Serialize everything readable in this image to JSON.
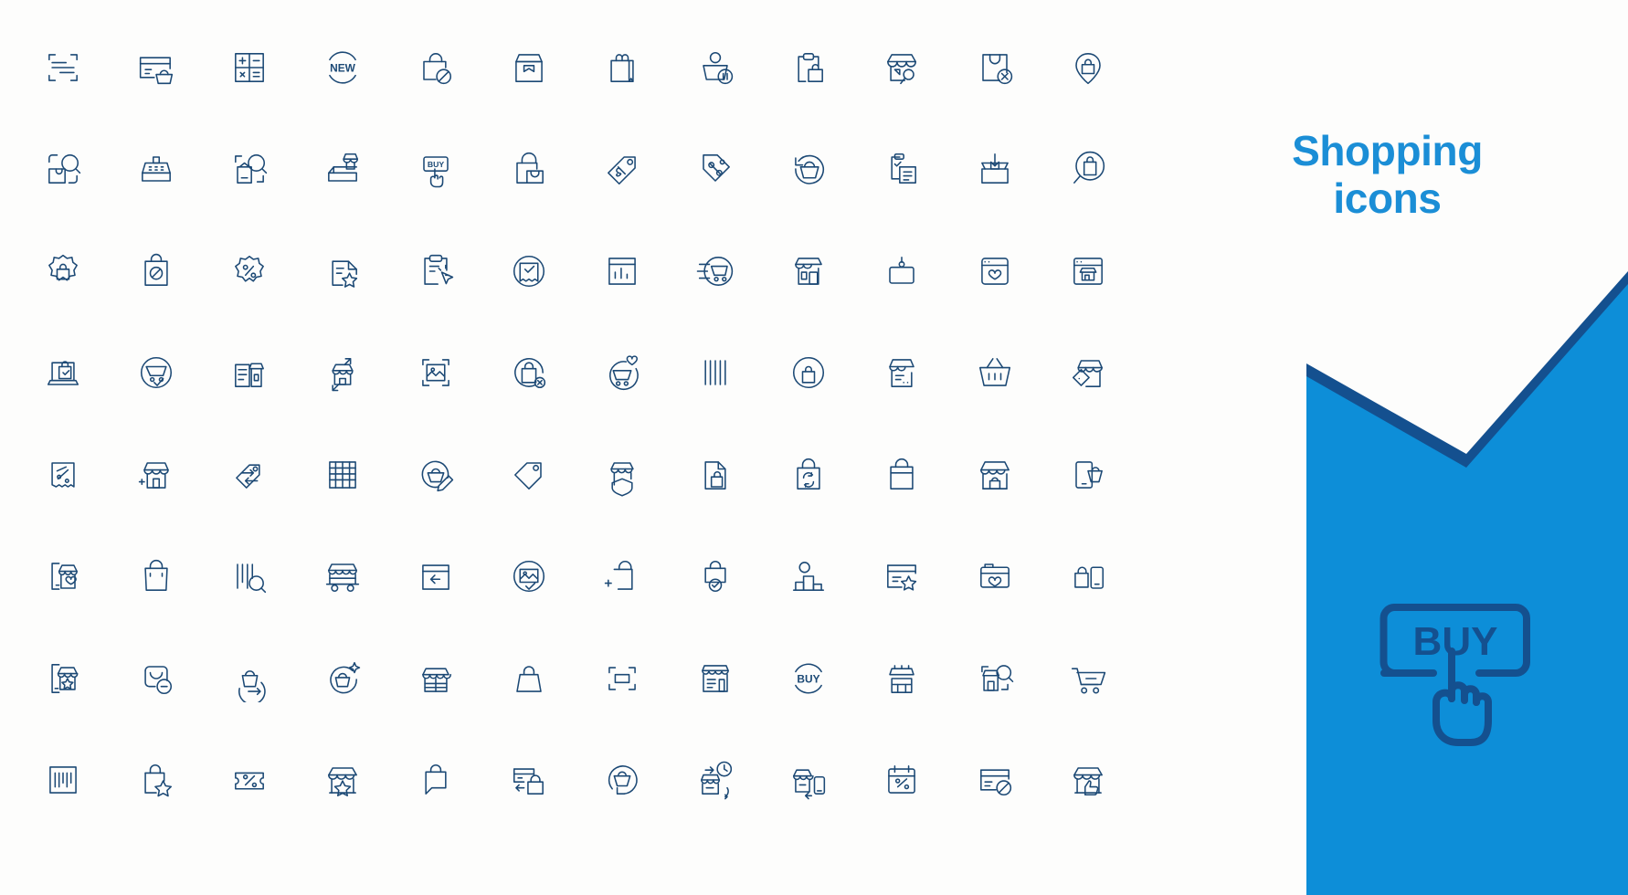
{
  "panel": {
    "title": "Shopping\nicons",
    "title_color": "#1b8ed6",
    "body_color": "#0d8ed8",
    "edge_color": "#14508f",
    "buy_label": "BUY"
  },
  "grid": {
    "columns": 12,
    "rows": 8,
    "stroke_color": "#1c4975",
    "icons": [
      {
        "name": "barcode-scan-frame-icon",
        "label": "Barcode scan frame"
      },
      {
        "name": "credit-card-basket-icon",
        "label": "Credit card with basket"
      },
      {
        "name": "calculator-icon",
        "label": "Calculator"
      },
      {
        "name": "new-badge-icon",
        "label": "NEW badge"
      },
      {
        "name": "bag-blocked-icon",
        "label": "Shopping bag blocked"
      },
      {
        "name": "package-box-icon",
        "label": "Package box"
      },
      {
        "name": "paper-shopping-bag-icon",
        "label": "Paper shopping bag"
      },
      {
        "name": "basket-customer-pause-icon",
        "label": "Customer basket paused"
      },
      {
        "name": "clipboard-bag-icon",
        "label": "Clipboard with bag"
      },
      {
        "name": "store-search-icon",
        "label": "Store search"
      },
      {
        "name": "bag-remove-icon",
        "label": "Bag remove"
      },
      {
        "name": "bag-location-pin-icon",
        "label": "Bag location pin"
      },
      {
        "name": "bag-search-frame-icon",
        "label": "Bag search frame"
      },
      {
        "name": "cash-register-icon",
        "label": "Cash register"
      },
      {
        "name": "product-search-frame-icon",
        "label": "Product search frame"
      },
      {
        "name": "store-delivery-icon",
        "label": "Store delivery"
      },
      {
        "name": "buy-button-tap-icon",
        "label": "Buy button tap"
      },
      {
        "name": "bag-in-bag-icon",
        "label": "Bag inside bag"
      },
      {
        "name": "price-tags-icon",
        "label": "Price tags"
      },
      {
        "name": "discount-tag-icon",
        "label": "Discount percent tag"
      },
      {
        "name": "basket-refresh-icon",
        "label": "Basket refresh"
      },
      {
        "name": "checklist-clipboard-icon",
        "label": "Checklist clipboard"
      },
      {
        "name": "box-download-icon",
        "label": "Box download"
      },
      {
        "name": "bag-magnifier-icon",
        "label": "Bag magnifier"
      },
      {
        "name": "bag-discount-badge-icon",
        "label": "Bag discount badge"
      },
      {
        "name": "bag-blocked-square-icon",
        "label": "Bag blocked square"
      },
      {
        "name": "percent-badge-icon",
        "label": "Percent badge"
      },
      {
        "name": "favorite-list-icon",
        "label": "Favorite list"
      },
      {
        "name": "clipboard-click-icon",
        "label": "Clipboard click"
      },
      {
        "name": "receipt-check-circle-icon",
        "label": "Receipt check circle"
      },
      {
        "name": "sales-chart-icon",
        "label": "Sales chart"
      },
      {
        "name": "fast-cart-icon",
        "label": "Fast cart"
      },
      {
        "name": "mobile-store-icon",
        "label": "Mobile store"
      },
      {
        "name": "signboard-icon",
        "label": "Hanging signboard"
      },
      {
        "name": "favorite-store-icon",
        "label": "Favorite store"
      },
      {
        "name": "store-browser-icon",
        "label": "Online store browser"
      },
      {
        "name": "laptop-bag-check-icon",
        "label": "Laptop bag check"
      },
      {
        "name": "cart-check-circle-icon",
        "label": "Cart check circle"
      },
      {
        "name": "store-receipt-icon",
        "label": "Store receipt"
      },
      {
        "name": "store-transfer-icon",
        "label": "Store transfer"
      },
      {
        "name": "product-image-frame-icon",
        "label": "Product image frame"
      },
      {
        "name": "bag-remove-circle-icon",
        "label": "Bag remove circle"
      },
      {
        "name": "cart-favorite-circle-icon",
        "label": "Cart favorite circle"
      },
      {
        "name": "barcode-lines-icon",
        "label": "Barcode lines"
      },
      {
        "name": "bag-circle-icon",
        "label": "Bag in circle"
      },
      {
        "name": "store-info-icon",
        "label": "Store information"
      },
      {
        "name": "shopping-basket-icon",
        "label": "Shopping basket"
      },
      {
        "name": "store-tag-icon",
        "label": "Store tag"
      },
      {
        "name": "receipt-percent-icon",
        "label": "Receipt percent"
      },
      {
        "name": "store-add-icon",
        "label": "Store add"
      },
      {
        "name": "tag-swap-icon",
        "label": "Tag swap"
      },
      {
        "name": "abacus-icon",
        "label": "Abacus"
      },
      {
        "name": "basket-edit-circle-icon",
        "label": "Basket edit circle"
      },
      {
        "name": "tag-icon",
        "label": "Price tag"
      },
      {
        "name": "store-shield-icon",
        "label": "Store shield"
      },
      {
        "name": "document-bag-icon",
        "label": "Document with bag"
      },
      {
        "name": "bag-refresh-icon",
        "label": "Bag refresh"
      },
      {
        "name": "bag-plain-icon",
        "label": "Plain bag"
      },
      {
        "name": "market-stall-icon",
        "label": "Market stall"
      },
      {
        "name": "mobile-basket-icon",
        "label": "Mobile basket"
      },
      {
        "name": "mobile-store-favorite-icon",
        "label": "Mobile store favorite"
      },
      {
        "name": "bag-handle-icon",
        "label": "Bag with handle"
      },
      {
        "name": "barcode-search-icon",
        "label": "Barcode search"
      },
      {
        "name": "food-truck-icon",
        "label": "Food truck"
      },
      {
        "name": "return-box-icon",
        "label": "Return box"
      },
      {
        "name": "image-check-circle-icon",
        "label": "Image check circle"
      },
      {
        "name": "bag-add-icon",
        "label": "Bag add"
      },
      {
        "name": "bag-check-icon",
        "label": "Bag check"
      },
      {
        "name": "podium-seller-icon",
        "label": "Podium seller"
      },
      {
        "name": "card-star-icon",
        "label": "Card star"
      },
      {
        "name": "card-favorite-icon",
        "label": "Card favorite"
      },
      {
        "name": "bag-mobile-icon",
        "label": "Bag and mobile"
      },
      {
        "name": "mobile-store-star-icon",
        "label": "Mobile store star"
      },
      {
        "name": "bag-remove-rounded-icon",
        "label": "Bag remove rounded"
      },
      {
        "name": "basket-forward-circle-icon",
        "label": "Basket forward circle"
      },
      {
        "name": "basket-sparkle-circle-icon",
        "label": "Basket sparkle circle"
      },
      {
        "name": "store-front-icon",
        "label": "Store front"
      },
      {
        "name": "handbag-icon",
        "label": "Handbag"
      },
      {
        "name": "scan-frame-icon",
        "label": "Scan frame"
      },
      {
        "name": "store-list-icon",
        "label": "Store list"
      },
      {
        "name": "buy-circle-icon",
        "label": "Buy circle"
      },
      {
        "name": "stall-icon",
        "label": "Small stall"
      },
      {
        "name": "store-search-user-icon",
        "label": "Store search user"
      },
      {
        "name": "cart-remove-icon",
        "label": "Cart remove"
      },
      {
        "name": "barcode-square-icon",
        "label": "Barcode square"
      },
      {
        "name": "bag-star-icon",
        "label": "Bag star"
      },
      {
        "name": "coupon-percent-icon",
        "label": "Coupon percent"
      },
      {
        "name": "store-star-icon",
        "label": "Store star"
      },
      {
        "name": "bag-chat-icon",
        "label": "Bag chat"
      },
      {
        "name": "card-bag-transfer-icon",
        "label": "Card bag transfer"
      },
      {
        "name": "basket-return-circle-icon",
        "label": "Basket return circle"
      },
      {
        "name": "store-schedule-icon",
        "label": "Store schedule"
      },
      {
        "name": "store-mobile-sync-icon",
        "label": "Store mobile sync"
      },
      {
        "name": "calendar-percent-icon",
        "label": "Calendar percent"
      },
      {
        "name": "card-blocked-icon",
        "label": "Card blocked"
      },
      {
        "name": "store-like-icon",
        "label": "Store like"
      }
    ]
  }
}
